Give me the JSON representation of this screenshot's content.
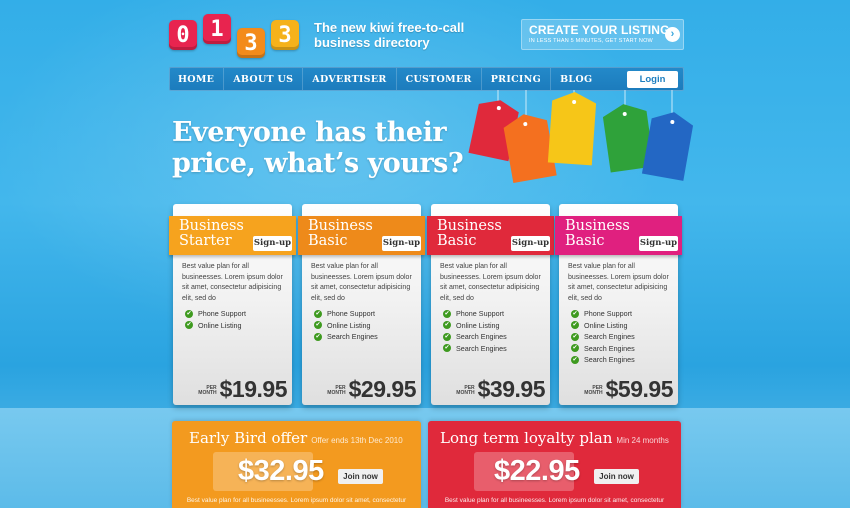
{
  "logo": {
    "digits": [
      "0",
      "1",
      "3",
      "3"
    ]
  },
  "tagline": "The new kiwi free-to-call business directory",
  "cta": {
    "title": "CREATE YOUR LISTING",
    "subtitle": "IN LESS THAN 5 MINUTES, GET START NOW",
    "arrow": "›"
  },
  "nav": {
    "items": [
      "HOME",
      "ABOUT US",
      "ADVERTISER",
      "CUSTOMER",
      "PRICING",
      "BLOG"
    ],
    "login": "Login"
  },
  "hero": {
    "line1": "Everyone has their",
    "line2": "price, what’s yours?"
  },
  "colors": {
    "orange": "#f39a1f",
    "orange_dark": "#ee8a1a",
    "red": "#e0293b",
    "magenta": "#e0207f",
    "green": "#2fa23a",
    "blue": "#2367c4",
    "yellow": "#f6c618"
  },
  "plans": [
    {
      "name_line1": "Business",
      "name_line2": "Starter",
      "signup": "Sign-up",
      "description": "Best value plan for all busineesses. Lorem ipsum dolor sit amet, consectetur adipisicing elit, sed do",
      "features": [
        "Phone Support",
        "Online Listing"
      ],
      "per_line1": "PER",
      "per_line2": "MONTH",
      "price": "$19.95",
      "color": "#f6a31e"
    },
    {
      "name_line1": "Business",
      "name_line2": "Basic",
      "signup": "Sign-up",
      "description": "Best value plan for all busineesses. Lorem ipsum dolor sit amet, consectetur adipisicing elit, sed do",
      "features": [
        "Phone Support",
        "Online Listing",
        "Search Engines"
      ],
      "per_line1": "PER",
      "per_line2": "MONTH",
      "price": "$29.95",
      "color": "#ee8a1a"
    },
    {
      "name_line1": "Business",
      "name_line2": "Basic",
      "signup": "Sign-up",
      "description": "Best value plan for all busineesses. Lorem ipsum dolor sit amet, consectetur adipisicing elit, sed do",
      "features": [
        "Phone Support",
        "Online Listing",
        "Search Engines",
        "Search Engines"
      ],
      "per_line1": "PER",
      "per_line2": "MONTH",
      "price": "$39.95",
      "color": "#e0293b"
    },
    {
      "name_line1": "Business",
      "name_line2": "Basic",
      "signup": "Sign-up",
      "description": "Best value plan for all busineesses. Lorem ipsum dolor sit amet, consectetur adipisicing elit, sed do",
      "features": [
        "Phone Support",
        "Online Listing",
        "Search Engines",
        "Search Engines",
        "Search Engines"
      ],
      "per_line1": "PER",
      "per_line2": "MONTH",
      "price": "$59.95",
      "color": "#e0207f"
    }
  ],
  "offers": [
    {
      "title": "Early Bird offer",
      "subtitle": "Offer ends 13th Dec 2010",
      "price": "$32.95",
      "join": "Join now",
      "description": "Best value plan for all busineesses. Lorem ipsum dolor sit amet, consectetur",
      "color": "#f39a1f"
    },
    {
      "title": "Long term loyalty plan",
      "subtitle": "Min 24 months",
      "price": "$22.95",
      "join": "Join now",
      "description": "Best value plan for all busineesses. Lorem ipsum dolor sit amet, consectetur",
      "color": "#e0293b"
    }
  ]
}
